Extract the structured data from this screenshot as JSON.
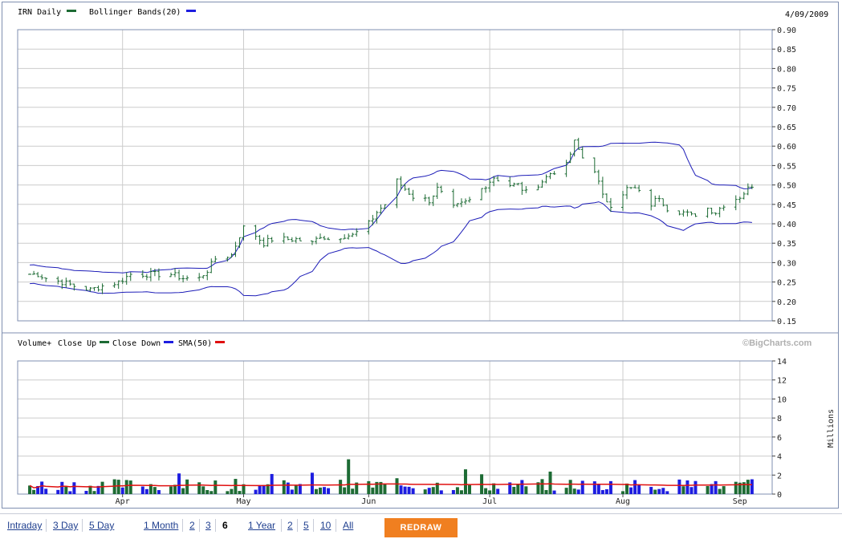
{
  "header": {
    "series_label": "IRN Daily",
    "bands_label": "Bollinger Bands(20)",
    "date": "4/09/2009"
  },
  "volume_header": {
    "label": "Volume+",
    "close_up": "Close Up",
    "close_down": "Close Down",
    "sma": "SMA(50)",
    "credit": "©BigCharts.com"
  },
  "colors": {
    "up": "#1d6b34",
    "down": "#1d1de0",
    "sma": "#e01010",
    "band": "#1d1db8",
    "grid": "#cccccc",
    "frame": "#7f8fb0"
  },
  "chart_data": [
    {
      "type": "line",
      "title": "IRN Daily",
      "series": [
        {
          "name": "IRN Daily"
        },
        {
          "name": "Bollinger Bands(20)"
        }
      ],
      "x_months": [
        {
          "label": "Apr",
          "date": "2009-04-01"
        },
        {
          "label": "May",
          "date": "2009-05-01"
        },
        {
          "label": "Jun",
          "date": "2009-06-01"
        },
        {
          "label": "Jul",
          "date": "2009-07-01"
        },
        {
          "label": "Aug",
          "date": "2009-08-03"
        },
        {
          "label": "Sep",
          "date": "2009-09-01"
        }
      ],
      "price_ohlc_range": [
        "2009-03-09",
        "2009-09-04"
      ],
      "price_points": [
        [
          "2009-03-09",
          0.27
        ],
        [
          "2009-03-11",
          0.27
        ],
        [
          "2009-03-13",
          0.26
        ],
        [
          "2009-03-17",
          0.25
        ],
        [
          "2009-03-20",
          0.24
        ],
        [
          "2009-03-24",
          0.23
        ],
        [
          "2009-03-27",
          0.24
        ],
        [
          "2009-03-31",
          0.25
        ],
        [
          "2009-04-03",
          0.27
        ],
        [
          "2009-04-07",
          0.27
        ],
        [
          "2009-04-13",
          0.27
        ],
        [
          "2009-04-16",
          0.26
        ],
        [
          "2009-04-20",
          0.26
        ],
        [
          "2009-04-22",
          0.28
        ],
        [
          "2009-04-24",
          0.31
        ],
        [
          "2009-04-28",
          0.32
        ],
        [
          "2009-04-30",
          0.37
        ],
        [
          "2009-05-01",
          0.39
        ],
        [
          "2009-05-04",
          0.37
        ],
        [
          "2009-05-06",
          0.35
        ],
        [
          "2009-05-08",
          0.36
        ],
        [
          "2009-05-12",
          0.36
        ],
        [
          "2009-05-14",
          0.36
        ],
        [
          "2009-05-18",
          0.35
        ],
        [
          "2009-05-20",
          0.37
        ],
        [
          "2009-05-22",
          0.36
        ],
        [
          "2009-05-26",
          0.37
        ],
        [
          "2009-05-28",
          0.37
        ],
        [
          "2009-06-01",
          0.4
        ],
        [
          "2009-06-03",
          0.43
        ],
        [
          "2009-06-05",
          0.45
        ],
        [
          "2009-06-08",
          0.51
        ],
        [
          "2009-06-10",
          0.49
        ],
        [
          "2009-06-12",
          0.47
        ],
        [
          "2009-06-16",
          0.46
        ],
        [
          "2009-06-18",
          0.49
        ],
        [
          "2009-06-22",
          0.44
        ],
        [
          "2009-06-24",
          0.45
        ],
        [
          "2009-06-26",
          0.46
        ],
        [
          "2009-06-30",
          0.5
        ],
        [
          "2009-07-02",
          0.52
        ],
        [
          "2009-07-06",
          0.5
        ],
        [
          "2009-07-08",
          0.5
        ],
        [
          "2009-07-10",
          0.48
        ],
        [
          "2009-07-14",
          0.51
        ],
        [
          "2009-07-16",
          0.53
        ],
        [
          "2009-07-20",
          0.55
        ],
        [
          "2009-07-22",
          0.61
        ],
        [
          "2009-07-24",
          0.57
        ],
        [
          "2009-07-27",
          0.54
        ],
        [
          "2009-07-29",
          0.47
        ],
        [
          "2009-07-31",
          0.45
        ],
        [
          "2009-08-04",
          0.49
        ],
        [
          "2009-08-06",
          0.49
        ],
        [
          "2009-08-10",
          0.45
        ],
        [
          "2009-08-12",
          0.47
        ],
        [
          "2009-08-14",
          0.44
        ],
        [
          "2009-08-18",
          0.43
        ],
        [
          "2009-08-20",
          0.42
        ],
        [
          "2009-08-24",
          0.44
        ],
        [
          "2009-08-26",
          0.43
        ],
        [
          "2009-08-28",
          0.45
        ],
        [
          "2009-09-01",
          0.47
        ],
        [
          "2009-09-04",
          0.5
        ]
      ],
      "ylim": [
        0.15,
        0.9
      ],
      "y_ticks": [
        "0.15",
        "0.20",
        "0.25",
        "0.30",
        "0.35",
        "0.40",
        "0.45",
        "0.50",
        "0.55",
        "0.60",
        "0.65",
        "0.70",
        "0.75",
        "0.80",
        "0.85",
        "0.90"
      ]
    },
    {
      "type": "bar",
      "title": "Volume+",
      "ylabel": "Millions",
      "ylim": [
        0,
        14
      ],
      "y_ticks": [
        "0",
        "2",
        "4",
        "6",
        "8",
        "10",
        "12",
        "14"
      ],
      "series": [
        {
          "name": "Close Up"
        },
        {
          "name": "Close Down"
        },
        {
          "name": "SMA(50)"
        }
      ]
    }
  ],
  "nav": {
    "intraday": "Intraday",
    "d3": "3 Day",
    "d5": "5 Day",
    "m1": "1 Month",
    "m2": "2",
    "m3": "3",
    "m6": "6",
    "y1": "1 Year",
    "y2": "2",
    "y5": "5",
    "y10": "10",
    "all": "All",
    "redraw": "REDRAW"
  }
}
